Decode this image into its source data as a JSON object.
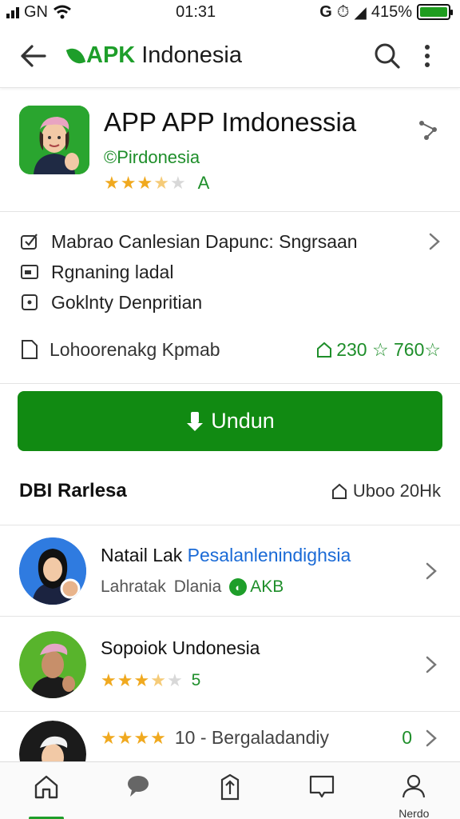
{
  "status": {
    "carrier": "GN",
    "time": "01:31",
    "battery": "415%",
    "battery_level": 1.0
  },
  "appbar": {
    "brand_accent": "APK",
    "brand_rest": "Indonesia"
  },
  "app": {
    "title": "APP APP Imdonessia",
    "developer": "©Pirdonesia",
    "rating_stars": 3.5,
    "rating_label": "A"
  },
  "details": {
    "rows": [
      {
        "icon": "checkbox-icon",
        "text": "Mabrao Canlesian Dapunc: Sngrsaan"
      },
      {
        "icon": "storage-icon",
        "text": "Rgnaning ladal"
      },
      {
        "icon": "square-dot-icon",
        "text": "Goklnty Denpritian"
      }
    ],
    "size_label": "Lohoorenakg Kpmab",
    "size_stat": "230 ☆ 760☆"
  },
  "install": {
    "label": "Undun"
  },
  "section": {
    "title": "DBI Rarlesa",
    "stat": "Uboo 20Hk"
  },
  "list": [
    {
      "title": "Natail Lak",
      "title_link": "Pesalanlenindighsia",
      "sub_a": "Lahratak",
      "sub_b": "Dlania",
      "badge": "AKB"
    },
    {
      "title": "Sopoiok Undonesia",
      "rating_stars": 3.5,
      "rating_value": "5"
    },
    {
      "title_prefix": "★★★★",
      "title": "10 - Bergaladandiy",
      "value": "0"
    }
  ],
  "nav": [
    {
      "icon": "home-icon",
      "label": ""
    },
    {
      "icon": "chat-icon",
      "label": ""
    },
    {
      "icon": "upload-icon",
      "label": ""
    },
    {
      "icon": "bookmark-icon",
      "label": ""
    },
    {
      "icon": "profile-icon",
      "label": "Nerdo"
    }
  ],
  "colors": {
    "brand_green": "#1e9e2a",
    "install_green": "#118a12",
    "link_blue": "#1a6ad6",
    "star": "#f0a91f"
  }
}
